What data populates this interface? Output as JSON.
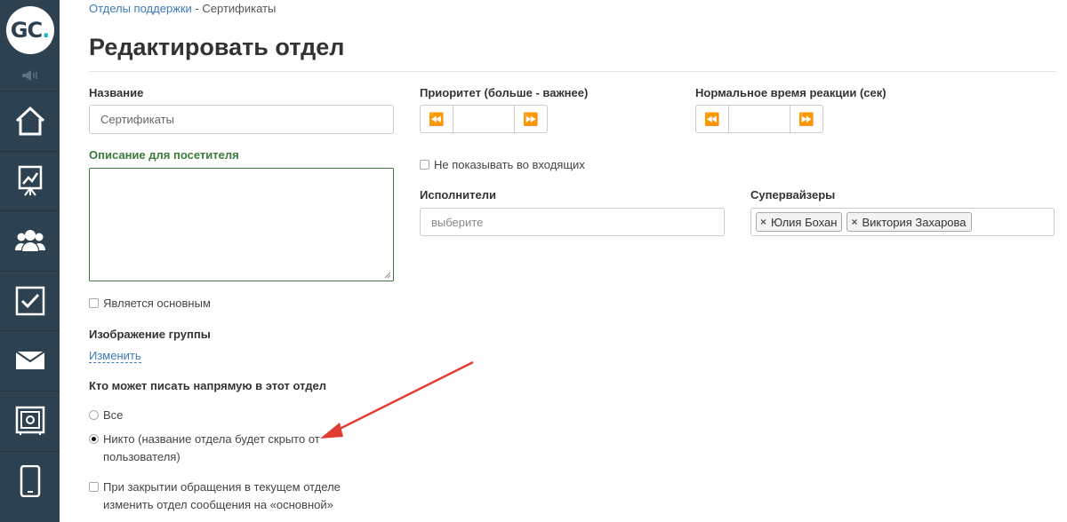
{
  "logo": {
    "g": "G",
    "c": "C",
    "dot": "."
  },
  "breadcrumb": {
    "parent": "Отделы поддержки",
    "separator": " - ",
    "current": "Сертификаты"
  },
  "page": {
    "title": "Редактировать отдел"
  },
  "form": {
    "name_label": "Название",
    "name_value": "Сертификаты",
    "description_label": "Описание для посетителя",
    "description_value": "",
    "is_main_label": "Является основным",
    "image_label": "Изображение группы",
    "image_change_link": "Изменить",
    "who_can_write_label": "Кто может писать напрямую в этот отдел",
    "option_all": "Все",
    "option_nobody_line1": "Никто (название отдела будет скрыто от",
    "option_nobody_line2": "пользователя)",
    "close_line1": "При закрытии обращения в текущем отделе",
    "close_line2": "изменить отдел сообщения на «основной»",
    "priority_label": "Приоритет (больше - важнее)",
    "priority_value": "",
    "reaction_label": "Нормальное время реакции (сек)",
    "reaction_value": "",
    "hide_incoming_label": "Не показывать во входящих",
    "executors_label": "Исполнители",
    "executors_placeholder": "выберите",
    "supervisors_label": "Супервайзеры",
    "supervisors": [
      "Юлия Бохан",
      "Виктория Захарова"
    ],
    "tag_remove_glyph": "×"
  },
  "stepper_icons": {
    "decrement": "⏪",
    "increment": "⏩"
  },
  "state": {
    "is_main_checked": false,
    "hide_incoming_checked": false,
    "who_can_write_selected": "nobody",
    "close_change_checked": false
  },
  "colors": {
    "sidebar": "#2d4150",
    "accent_link": "#3e79b8",
    "description_border": "#3c7a3c",
    "annotation_arrow": "#e03c31"
  },
  "sidebar_icons": [
    "speaker-icon",
    "home-icon",
    "chart-icon",
    "users-icon",
    "tasks-icon",
    "mail-icon",
    "safe-icon",
    "mobile-icon"
  ]
}
